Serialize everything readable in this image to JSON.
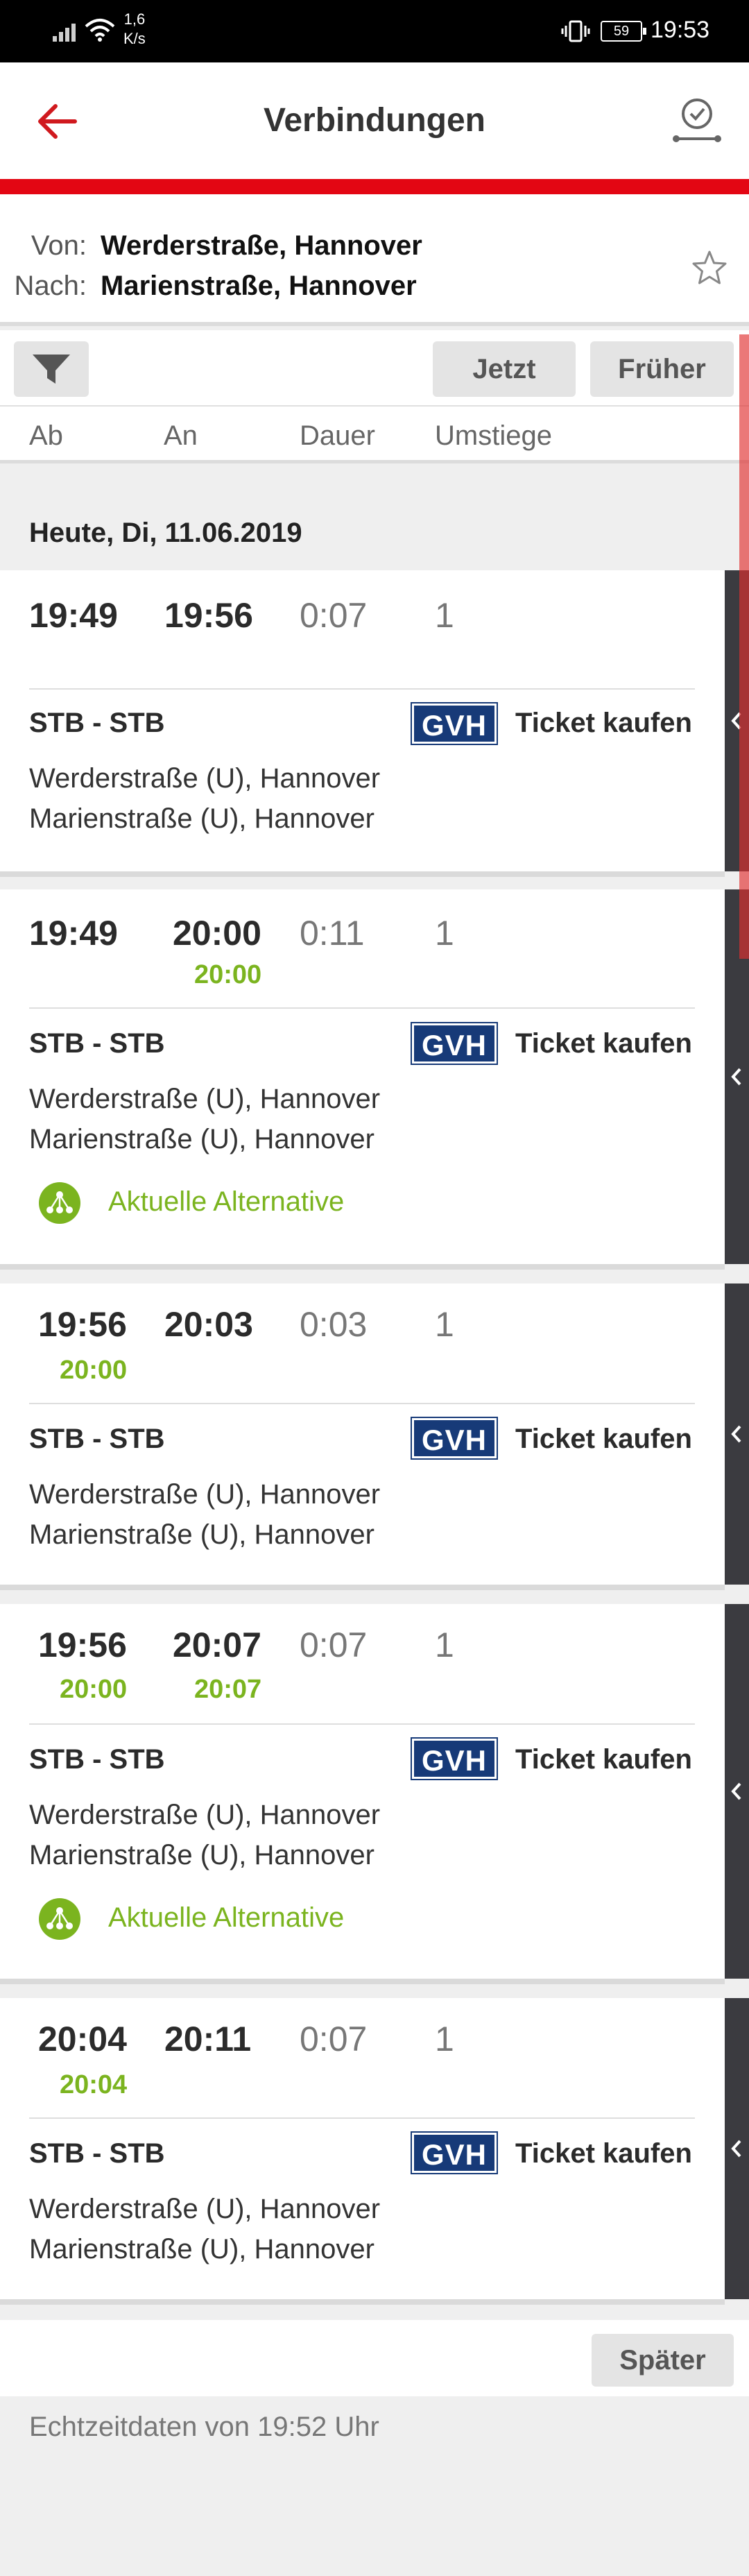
{
  "status_bar": {
    "speed_value": "1,6",
    "speed_unit": "K/s",
    "battery": "59",
    "time": "19:53"
  },
  "header": {
    "title": "Verbindungen",
    "back_icon": "arrow-left-icon",
    "time_icon": "clock-route-icon",
    "accent_color": "#e30613"
  },
  "route": {
    "from_label": "Von:",
    "from_value": "Werderstraße, Hannover",
    "to_label": "Nach:",
    "to_value": "Marienstraße, Hannover",
    "favorite_icon": "star-outline-icon"
  },
  "toolbar": {
    "filter_icon": "filter-icon",
    "now_label": "Jetzt",
    "earlier_label": "Früher"
  },
  "columns": {
    "departure": "Ab",
    "arrival": "An",
    "duration": "Dauer",
    "transfers": "Umstiege"
  },
  "date_header": "Heute, Di, 11.06.2019",
  "connections": [
    {
      "dep": "19:49",
      "arr": "19:56",
      "dur": "0:07",
      "transfers": "1",
      "dep_rt": "",
      "arr_rt": "",
      "line": "STB - STB",
      "operator": "GVH",
      "ticket": "Ticket kaufen",
      "from_stop": "Werderstraße (U), Hannover",
      "to_stop": "Marienstraße (U), Hannover",
      "alternative": ""
    },
    {
      "dep": "19:49",
      "arr": "20:00",
      "dur": "0:11",
      "transfers": "1",
      "dep_rt": "",
      "arr_rt": "20:00",
      "line": "STB - STB",
      "operator": "GVH",
      "ticket": "Ticket kaufen",
      "from_stop": "Werderstraße (U), Hannover",
      "to_stop": "Marienstraße (U), Hannover",
      "alternative": "Aktuelle Alternative"
    },
    {
      "dep": "19:56",
      "arr": "20:03",
      "dur": "0:03",
      "transfers": "1",
      "dep_rt": "20:00",
      "arr_rt": "",
      "line": "STB - STB",
      "operator": "GVH",
      "ticket": "Ticket kaufen",
      "from_stop": "Werderstraße (U), Hannover",
      "to_stop": "Marienstraße (U), Hannover",
      "alternative": ""
    },
    {
      "dep": "19:56",
      "arr": "20:07",
      "dur": "0:07",
      "transfers": "1",
      "dep_rt": "20:00",
      "arr_rt": "20:07",
      "line": "STB - STB",
      "operator": "GVH",
      "ticket": "Ticket kaufen",
      "from_stop": "Werderstraße (U), Hannover",
      "to_stop": "Marienstraße (U), Hannover",
      "alternative": "Aktuelle Alternative"
    },
    {
      "dep": "20:04",
      "arr": "20:11",
      "dur": "0:07",
      "transfers": "1",
      "dep_rt": "20:04",
      "arr_rt": "",
      "line": "STB - STB",
      "operator": "GVH",
      "ticket": "Ticket kaufen",
      "from_stop": "Werderstraße (U), Hannover",
      "to_stop": "Marienstraße (U), Hannover",
      "alternative": ""
    }
  ],
  "later_label": "Später",
  "footer_text": "Echtzeitdaten von 19:52 Uhr",
  "colors": {
    "realtime_green": "#7bb41f",
    "gvh_blue": "#173a78"
  }
}
